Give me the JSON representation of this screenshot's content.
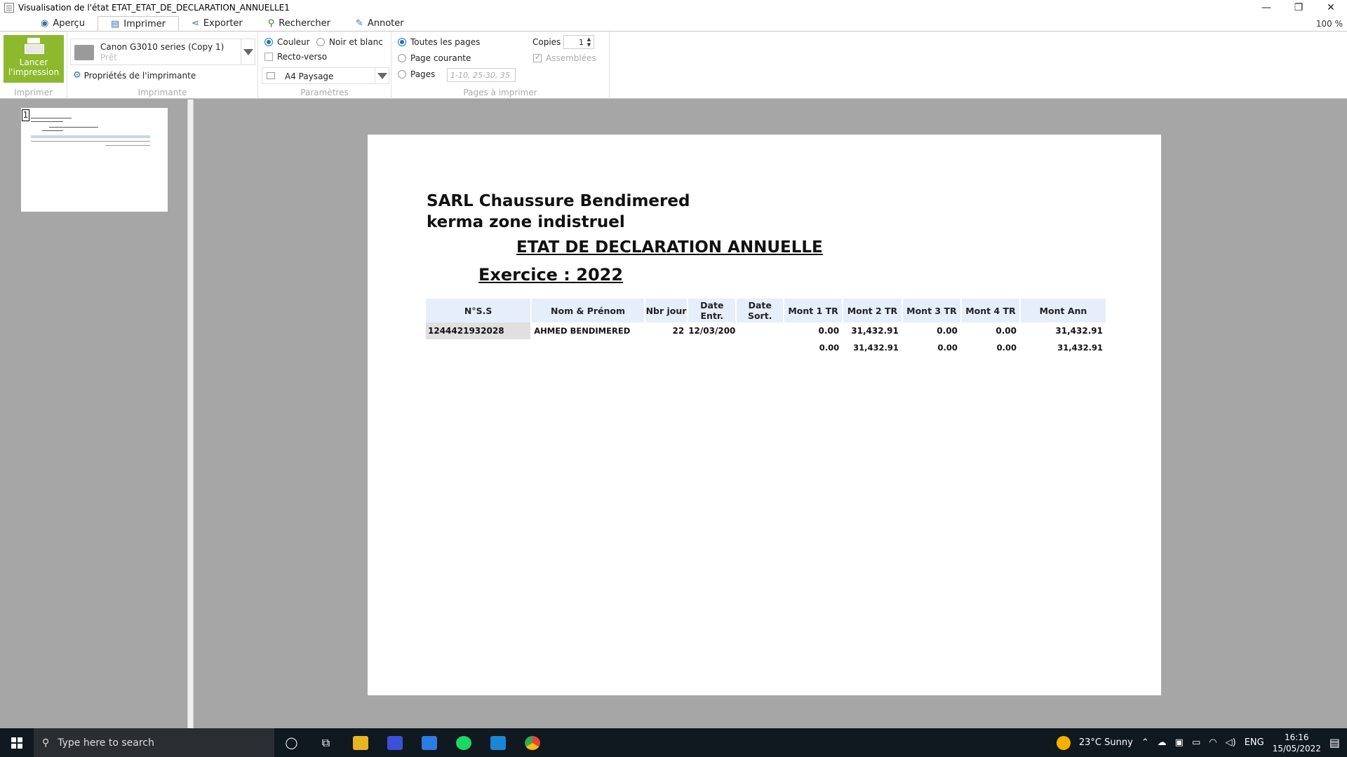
{
  "window": {
    "title": "Visualisation de l'état ETAT_ETAT_DE_DECLARATION_ANNUELLE1",
    "minimize": "—",
    "restore": "❐",
    "close": "✕",
    "zoom": "100 %"
  },
  "tabs": [
    {
      "label": "Aperçu",
      "icon": "eye-icon"
    },
    {
      "label": "Imprimer",
      "icon": "printer-icon",
      "active": true
    },
    {
      "label": "Exporter",
      "icon": "share-icon"
    },
    {
      "label": "Rechercher",
      "icon": "search-icon"
    },
    {
      "label": "Annoter",
      "icon": "pencil-icon"
    }
  ],
  "ribbon": {
    "print_button": "Lancer l'impression",
    "printer_name": "Canon G3010 series (Copy 1)",
    "printer_status": "Prêt",
    "printer_properties": "Propriétés de l'imprimante",
    "color_option": "Couleur",
    "bw_option": "Noir et blanc",
    "duplex_option": "Recto-verso",
    "paper": "A4 Paysage",
    "all_pages": "Toutes les pages",
    "current_page": "Page courante",
    "pages": "Pages",
    "pages_placeholder": "1-10, 25-30, 35",
    "copies_label": "Copies",
    "copies_value": "1",
    "collated": "Assemblées",
    "groups": [
      "Imprimer",
      "Imprimante",
      "Paramètres",
      "Pages à imprimer"
    ]
  },
  "thumbnail": {
    "page_number": "1"
  },
  "report": {
    "company_line1": "SARL Chaussure Bendimered",
    "company_line2": "kerma zone indistruel",
    "title": "ETAT DE DECLARATION ANNUELLE",
    "exercise": "Exercice : 2022",
    "columns": [
      "N°S.S",
      "Nom & Prénom",
      "Nbr jour",
      "Date Entr.",
      "Date Sort.",
      "Mont 1 TR",
      "Mont 2 TR",
      "Mont 3 TR",
      "Mont 4 TR",
      "Mont Ann"
    ],
    "rows": [
      {
        "nss": "1244421932028",
        "name": "AHMED BENDIMERED",
        "days": "22",
        "date_in": "12/03/200",
        "date_out": "",
        "m1": "0.00",
        "m2": "31,432.91",
        "m3": "0.00",
        "m4": "0.00",
        "annual": "31,432.91"
      }
    ],
    "totals": {
      "m1": "0.00",
      "m2": "31,432.91",
      "m3": "0.00",
      "m4": "0.00",
      "annual": "31,432.91"
    }
  },
  "taskbar": {
    "search_placeholder": "Type here to search",
    "weather": "23°C  Sunny",
    "language": "ENG",
    "time": "16:16",
    "date": "15/05/2022"
  }
}
